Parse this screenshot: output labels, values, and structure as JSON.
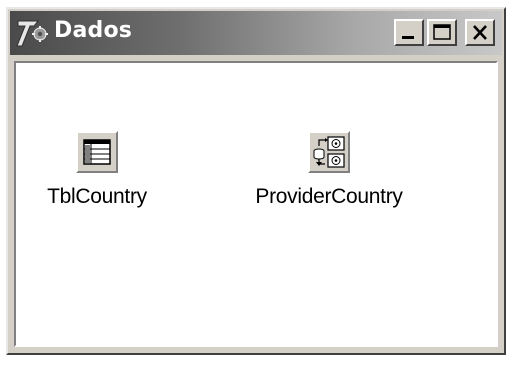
{
  "window": {
    "title": "Dados",
    "app_icon": "delphi-icon",
    "buttons": {
      "minimize": "minimize-icon",
      "maximize": "maximize-icon",
      "close": "close-icon"
    }
  },
  "components": [
    {
      "label": "TblCountry",
      "icon": "table-icon"
    },
    {
      "label": "ProviderCountry",
      "icon": "provider-icon"
    }
  ],
  "colors": {
    "face": "#d4d0c8",
    "titlebar_start": "#4a4a4a",
    "titlebar_end": "#c8c8c8",
    "client_bg": "#ffffff"
  }
}
